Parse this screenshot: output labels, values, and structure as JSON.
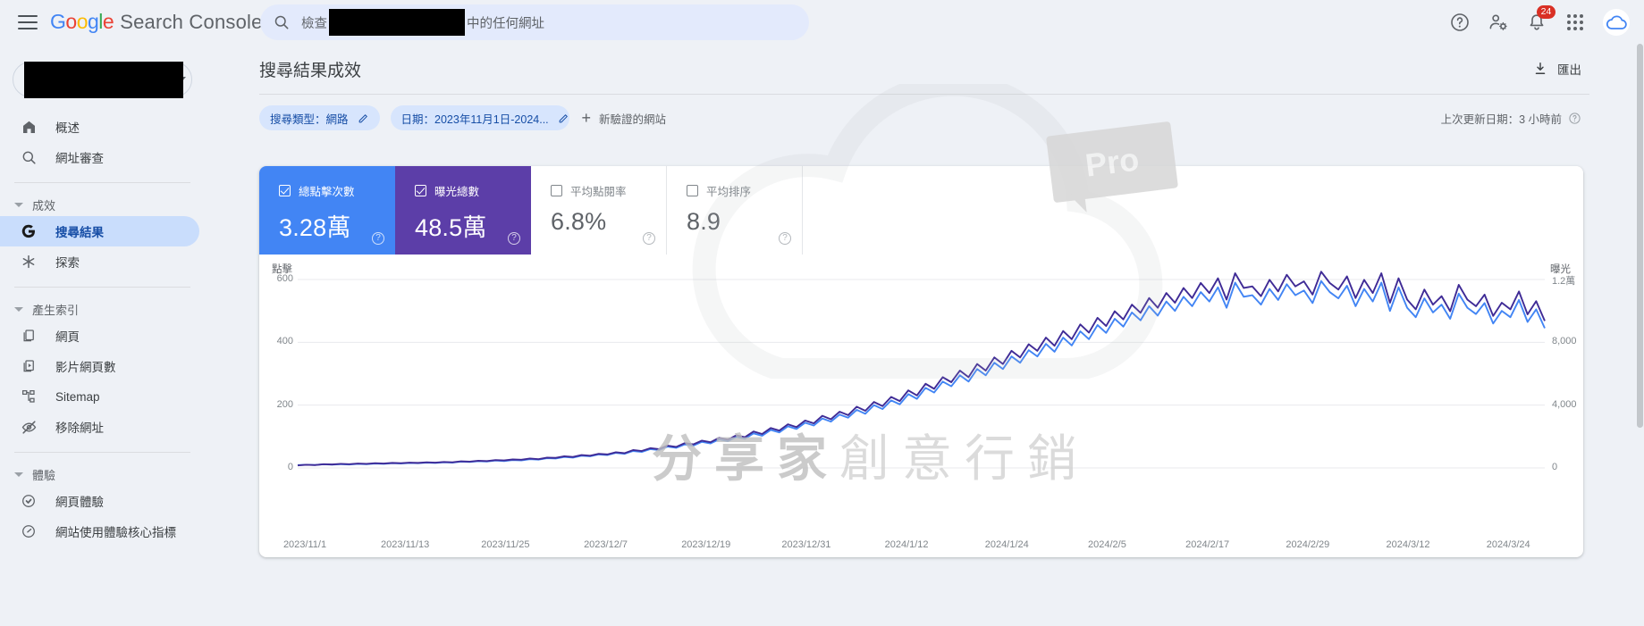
{
  "topbar": {
    "menu_icon": "hamburger-icon",
    "brand_google": [
      "G",
      "o",
      "o",
      "g",
      "l",
      "e"
    ],
    "brand_rest": "Search Console",
    "search": {
      "icon": "search-icon",
      "prefix": "檢查",
      "suffix": "中的任何網址",
      "redacted": true
    },
    "icons": {
      "help": "help-icon",
      "account_settings": "account-settings-icon",
      "notifications": "notification-bell-icon",
      "apps": "apps-grid-icon",
      "avatar": "cloud-avatar-icon"
    },
    "notification_count": "24"
  },
  "sidebar": {
    "property_redacted": true,
    "items": [
      {
        "label": "概述",
        "icon": "home-icon",
        "active": false
      },
      {
        "label": "網址審查",
        "icon": "search-icon",
        "active": false
      }
    ],
    "groups": [
      {
        "label": "成效",
        "items": [
          {
            "label": "搜尋結果",
            "icon": "google-g-icon",
            "active": true
          },
          {
            "label": "探索",
            "icon": "discover-asterisk-icon",
            "active": false
          }
        ]
      },
      {
        "label": "產生索引",
        "items": [
          {
            "label": "網頁",
            "icon": "pages-icon",
            "active": false
          },
          {
            "label": "影片網頁數",
            "icon": "video-pages-icon",
            "active": false
          },
          {
            "label": "Sitemap",
            "icon": "sitemap-icon",
            "active": false
          },
          {
            "label": "移除網址",
            "icon": "removals-eye-off-icon",
            "active": false
          }
        ]
      },
      {
        "label": "體驗",
        "items": [
          {
            "label": "網頁體驗",
            "icon": "page-experience-icon",
            "active": false
          },
          {
            "label": "網站使用體驗核心指標",
            "icon": "core-web-vitals-icon",
            "active": false
          }
        ]
      }
    ]
  },
  "page": {
    "title": "搜尋結果成效",
    "export_label": "匯出",
    "export_icon": "download-icon"
  },
  "filters": {
    "chips": [
      {
        "label": "搜尋類型：網路",
        "edit_icon": "pencil-icon"
      },
      {
        "label": "日期：2023年11月1日-2024...",
        "edit_icon": "pencil-icon"
      }
    ],
    "new_filter_label": "新驗證的網站",
    "new_filter_icon": "plus-icon",
    "last_update": "上次更新日期：3 小時前",
    "last_update_help_icon": "help-circle-icon"
  },
  "metrics": [
    {
      "label": "總點擊次數",
      "value": "3.28萬",
      "checked": true,
      "style": "clicks",
      "help_icon": "help-circle-icon"
    },
    {
      "label": "曝光總數",
      "value": "48.5萬",
      "checked": true,
      "style": "impr",
      "help_icon": "help-circle-icon"
    },
    {
      "label": "平均點閱率",
      "value": "6.8%",
      "checked": false,
      "style": "ctr",
      "help_icon": "help-circle-icon"
    },
    {
      "label": "平均排序",
      "value": "8.9",
      "checked": false,
      "style": "pos",
      "help_icon": "help-circle-icon"
    }
  ],
  "watermarks": {
    "pro": "Pro",
    "brand_main": "分享家",
    "brand_sub": "創意行銷",
    "cloud": "cloud-watermark-icon"
  },
  "colors": {
    "clicks": "#4285f4",
    "impressions": "#5c3ea8",
    "chip_bg": "#d7e5fd",
    "chip_text": "#174ea6",
    "badge": "#d93025",
    "card_bg": "#ffffff",
    "page_bg": "#eef1f6"
  },
  "chart_data": {
    "type": "line",
    "title": "搜尋結果成效",
    "xlabel": "",
    "ylabel": "點擊",
    "y2label": "曝光",
    "grid": true,
    "legend_position": "metric-cards",
    "ylim": [
      0,
      600
    ],
    "y2lim": [
      0,
      12000
    ],
    "yticks": [
      "0",
      "200",
      "400",
      "600"
    ],
    "y2ticks": [
      "0",
      "4,000",
      "8,000",
      "1.2萬"
    ],
    "xticks": [
      "2023/11/1",
      "2023/11/13",
      "2023/11/25",
      "2023/12/7",
      "2023/12/19",
      "2023/12/31",
      "2024/1/12",
      "2024/1/24",
      "2024/2/5",
      "2024/2/17",
      "2024/2/29",
      "2024/3/12",
      "2024/3/24"
    ],
    "x_start": "2023/11/1",
    "x_end": "2024/3/30",
    "series": [
      {
        "name": "曝光總數",
        "axis": "right",
        "color": "#4285f4",
        "values": [
          180,
          200,
          190,
          230,
          210,
          240,
          220,
          260,
          240,
          280,
          260,
          300,
          280,
          320,
          300,
          340,
          320,
          360,
          340,
          400,
          380,
          430,
          410,
          470,
          440,
          500,
          480,
          560,
          530,
          620,
          600,
          700,
          660,
          780,
          740,
          860,
          820,
          960,
          900,
          1080,
          1020,
          1200,
          1140,
          1360,
          1280,
          1500,
          1420,
          1660,
          1560,
          1820,
          1700,
          1980,
          1860,
          2200,
          2050,
          2420,
          2260,
          2650,
          2480,
          2880,
          2700,
          3150,
          2950,
          3400,
          3200,
          3700,
          3450,
          4000,
          3750,
          4300,
          4050,
          4700,
          4400,
          5100,
          4800,
          5500,
          5200,
          5900,
          5500,
          6300,
          5900,
          6700,
          6300,
          7100,
          6700,
          7500,
          7100,
          7900,
          7400,
          8300,
          7800,
          8700,
          8200,
          9100,
          8600,
          9500,
          9000,
          9900,
          9400,
          10300,
          9700,
          10600,
          10000,
          10900,
          10300,
          11200,
          10600,
          11500,
          10200,
          11800,
          10900,
          11000,
          10400,
          11400,
          10700,
          11700,
          11000,
          11300,
          10500,
          11900,
          11200,
          10800,
          11600,
          10300,
          11400,
          10600,
          11800,
          10000,
          11500,
          10200,
          9600,
          10800,
          9900,
          10400,
          9500,
          11100,
          10200,
          9800,
          10500,
          9200,
          10000,
          9600,
          10700,
          9300,
          10100,
          8900
        ]
      },
      {
        "name": "總點擊次數",
        "axis": "left",
        "color": "#3f2b96",
        "values": [
          8,
          10,
          9,
          12,
          11,
          13,
          12,
          14,
          13,
          15,
          14,
          16,
          15,
          17,
          16,
          18,
          17,
          19,
          18,
          21,
          20,
          23,
          22,
          25,
          24,
          27,
          26,
          30,
          28,
          33,
          32,
          37,
          35,
          41,
          39,
          45,
          43,
          50,
          47,
          57,
          54,
          63,
          60,
          71,
          67,
          79,
          75,
          87,
          82,
          96,
          90,
          104,
          98,
          116,
          108,
          127,
          119,
          139,
          130,
          151,
          142,
          166,
          155,
          179,
          168,
          195,
          182,
          210,
          197,
          226,
          213,
          247,
          231,
          268,
          252,
          289,
          273,
          310,
          289,
          331,
          310,
          352,
          331,
          373,
          352,
          394,
          373,
          415,
          389,
          436,
          410,
          457,
          431,
          478,
          452,
          499,
          473,
          520,
          494,
          541,
          510,
          557,
          526,
          573,
          541,
          589,
          557,
          604,
          536,
          620,
          573,
          578,
          547,
          599,
          562,
          615,
          578,
          594,
          552,
          625,
          589,
          568,
          610,
          541,
          599,
          557,
          620,
          526,
          604,
          536,
          505,
          568,
          520,
          547,
          499,
          583,
          536,
          515,
          552,
          484,
          526,
          505,
          562,
          489,
          531,
          468
        ]
      }
    ]
  }
}
